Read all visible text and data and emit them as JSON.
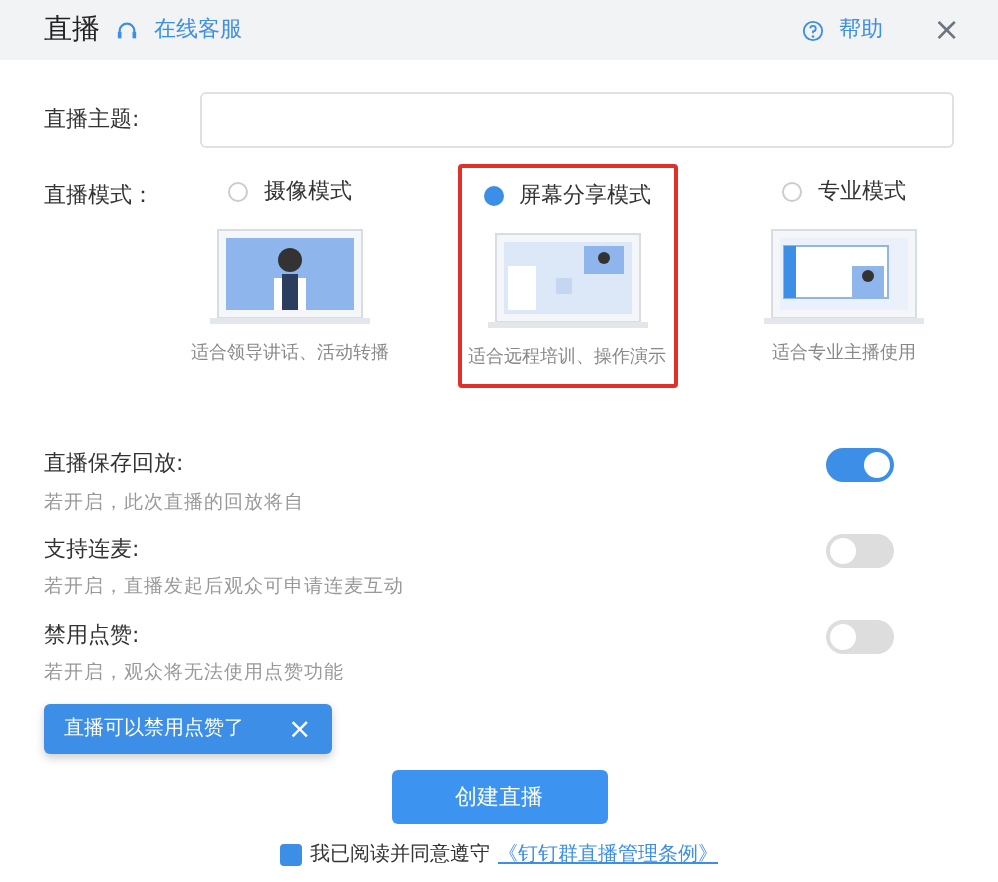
{
  "header": {
    "title": "直播",
    "service_link": "在线客服",
    "help": "帮助",
    "close": "×"
  },
  "topic": {
    "label": "直播主题:"
  },
  "mode": {
    "label": "直播模式：",
    "options": [
      {
        "label": "摄像模式",
        "selected": false,
        "caption": "适合领导讲话、活动转播",
        "kind": "camera"
      },
      {
        "label": "屏幕分享模式",
        "selected": true,
        "caption": "适合远程培训、操作演示",
        "kind": "screen"
      },
      {
        "label": "专业模式",
        "selected": false,
        "caption": "适合专业主播使用",
        "kind": "pro"
      }
    ]
  },
  "settings": [
    {
      "label": "直播保存回放:",
      "description": "若开启，此次直播的回放将自",
      "on": true
    },
    {
      "label": "支持连麦:",
      "description": "若开启，直播发起后观众可申请连麦互动",
      "on": false
    },
    {
      "label": "禁用点赞:",
      "description": "若开启，观众将无法使用点赞功能",
      "on": false
    }
  ],
  "tooltip": {
    "text": "直播可以禁用点赞了",
    "close": "×"
  },
  "create_button": "创建直播",
  "agreement": {
    "checked": true,
    "text": "我已阅读并同意遵守",
    "link": "《钉钉群直播管理条例》"
  }
}
